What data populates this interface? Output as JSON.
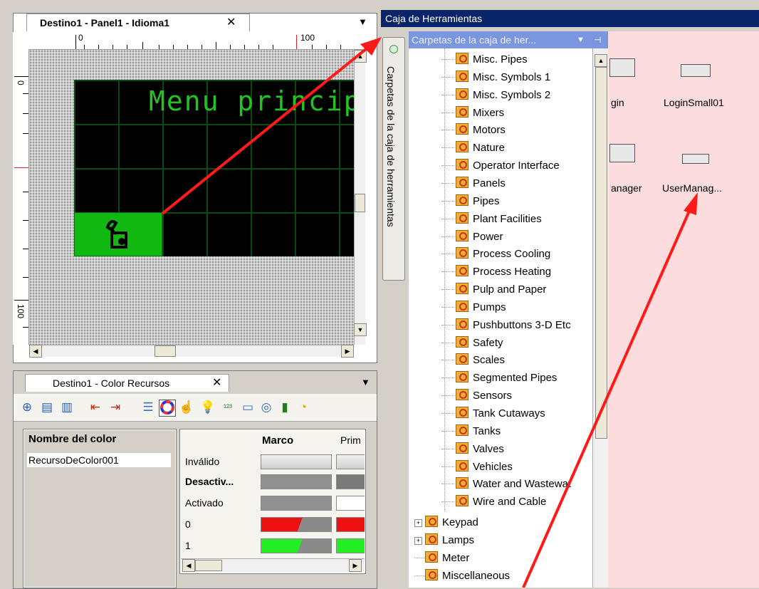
{
  "editor": {
    "tab_title": "Destino1 - Panel1 - Idioma1",
    "close_glyph": "✕",
    "dropdown_glyph": "▼",
    "ruler_top": [
      "0",
      "100"
    ],
    "ruler_left": [
      "0",
      "100"
    ],
    "panel_title": "Menu principal"
  },
  "color_resources": {
    "tab_title": "Destino1 - Color Recursos",
    "close_glyph": "✕",
    "dropdown_glyph": "▼",
    "name_header": "Nombre del color",
    "name_value": "RecursoDeColor001",
    "col_headers": [
      "Marco",
      "Prim"
    ],
    "rows": [
      {
        "label": "Inválido",
        "bold": false
      },
      {
        "label": "Desactiv...",
        "bold": true
      },
      {
        "label": "Activado",
        "bold": false
      },
      {
        "label": "0",
        "bold": false
      },
      {
        "label": "1",
        "bold": false
      }
    ],
    "toolbar_icons": [
      "add-color-icon",
      "add-row-icon",
      "delete-row-icon",
      "move-left-icon",
      "move-right-icon",
      "list-icon",
      "color-wheel-icon",
      "pointer-icon",
      "bulb-icon",
      "numeric-icon",
      "text-icon",
      "eye-icon",
      "bar-icon",
      "clock-icon"
    ]
  },
  "toolbox": {
    "title": "Caja de Herramientas",
    "side_tab": "Carpetas de la caja de herramientas",
    "folder_header": "Carpetas de la caja de her...",
    "folder_header_dropdown": "▼",
    "pin_glyph": "ꟷ⊣",
    "tree_items": [
      "Misc. Pipes",
      "Misc. Symbols 1",
      "Misc. Symbols 2",
      "Mixers",
      "Motors",
      "Nature",
      "Operator Interface",
      "Panels",
      "Pipes",
      "Plant Facilities",
      "Power",
      "Process Cooling",
      "Process Heating",
      "Pulp and Paper",
      "Pumps",
      "Pushbuttons 3-D Etc",
      "Safety",
      "Scales",
      "Segmented Pipes",
      "Sensors",
      "Tank Cutaways",
      "Tanks",
      "Valves",
      "Vehicles",
      "Water and Wastewat",
      "Wire and Cable"
    ],
    "tree_parent_items": [
      {
        "label": "Keypad",
        "expandable": true
      },
      {
        "label": "Lamps",
        "expandable": true
      },
      {
        "label": "Meter",
        "expandable": false
      },
      {
        "label": "Miscellaneous",
        "expandable": false
      }
    ],
    "items": [
      {
        "label": "gin"
      },
      {
        "label": "LoginSmall01"
      },
      {
        "label": "anager"
      },
      {
        "label": "UserManag..."
      }
    ]
  },
  "colors": {
    "accent_red": "#ff1a1a",
    "toolbox_header": "#0a246a",
    "panel_green": "#22c422"
  }
}
